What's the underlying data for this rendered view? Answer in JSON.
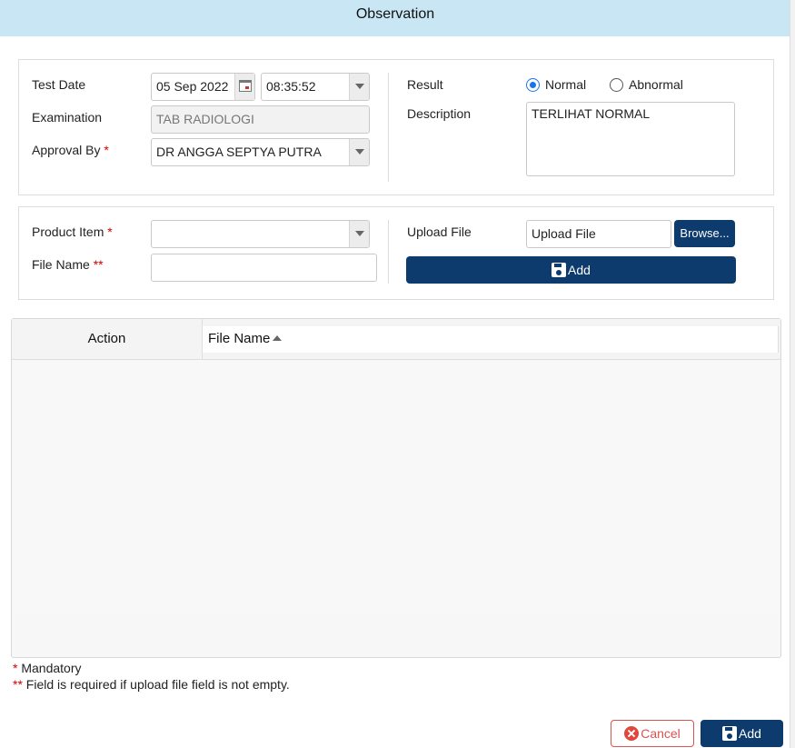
{
  "dialog": {
    "title": "Observation"
  },
  "form": {
    "test_date_label": "Test Date",
    "test_date_value": "05 Sep 2022",
    "test_time_value": "08:35:52",
    "examination_label": "Examination",
    "examination_value": "TAB RADIOLOGI",
    "approval_label": "Approval By",
    "approval_required": "*",
    "approval_value": "DR ANGGA SEPTYA PUTRA",
    "result_label": "Result",
    "result_options": [
      "Normal",
      "Abnormal"
    ],
    "result_selected": "Normal",
    "description_label": "Description",
    "description_value": "TERLIHAT NORMAL"
  },
  "upload": {
    "product_label": "Product Item",
    "product_required": "*",
    "product_value": "",
    "filename_label": "File Name",
    "filename_required": "**",
    "filename_value": "",
    "upload_label": "Upload File",
    "upload_placeholder": "Upload File",
    "browse_label": "Browse...",
    "add_label": "Add"
  },
  "grid": {
    "columns": [
      "Action",
      "File Name"
    ],
    "sort": {
      "column": "File Name",
      "direction": "ascending"
    },
    "rows": []
  },
  "notes": {
    "mandatory_mark": "*",
    "mandatory_text": " Mandatory",
    "conditional_mark": "**",
    "conditional_text": " Field is required if upload file field is not empty."
  },
  "footer": {
    "cancel_label": "Cancel",
    "add_label": "Add"
  },
  "colors": {
    "title_bar": "#c9e6f4",
    "primary": "#0d3b6e",
    "danger": "#d9534f",
    "required": "#d20000",
    "radio": "#1a73e8"
  }
}
